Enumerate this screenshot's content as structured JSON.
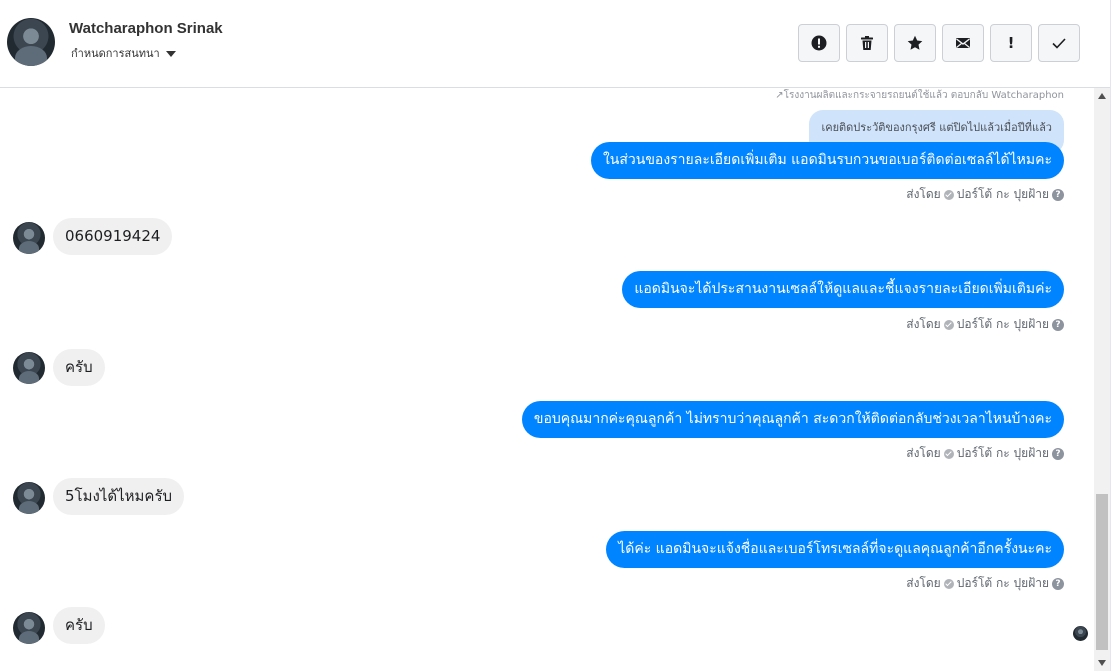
{
  "header": {
    "user_name": "Watcharaphon Srinak",
    "settings_label": "กำหนดการสนทนา",
    "actions": [
      {
        "name": "alert-button",
        "icon": "exclamation-circle-icon"
      },
      {
        "name": "delete-button",
        "icon": "trash-icon"
      },
      {
        "name": "star-button",
        "icon": "star-icon"
      },
      {
        "name": "mark-unread-button",
        "icon": "envelope-icon"
      },
      {
        "name": "important-button",
        "icon": "exclamation-icon",
        "glyph": "!"
      },
      {
        "name": "done-button",
        "icon": "checkmark-icon"
      }
    ]
  },
  "thread": {
    "reply_context": "โรงงานผลิตและกระจายรถยนต์ใช้แล้ว ตอบกลับ Watcharaphon",
    "quoted_text": "เคยติดประวัติของกรุงศรี แต่ปิดไปแล้วเมื่อปีที่แล้ว",
    "sent_by_label": "ส่งโดย",
    "sender_name": "ปอร์โต้ กะ ปุยฝ้าย",
    "help_glyph": "?",
    "messages": [
      {
        "dir": "out",
        "text": "ในส่วนของรายละเอียดเพิ่มเติม แอดมินรบกวนขอเบอร์ติดต่อเซลล์ได้ไหมคะ"
      },
      {
        "dir": "in",
        "text": "0660919424"
      },
      {
        "dir": "out",
        "text": "แอดมินจะได้ประสานงานเซลล์ให้ดูแลและชี้แจงรายละเอียดเพิ่มเติมค่ะ"
      },
      {
        "dir": "in",
        "text": "ครับ"
      },
      {
        "dir": "out",
        "text": "ขอบคุณมากค่ะคุณลูกค้า ไม่ทราบว่าคุณลูกค้า สะดวกให้ติดต่อกลับช่วงเวลาไหนบ้างคะ"
      },
      {
        "dir": "in",
        "text": "5โมงได้ไหมครับ"
      },
      {
        "dir": "out",
        "text": "ได้ค่ะ แอดมินจะแจ้งชื่อและเบอร์โทรเซลล์ที่จะดูแลคุณลูกค้าอีกครั้งนะคะ"
      },
      {
        "dir": "in",
        "text": "ครับ"
      }
    ]
  }
}
